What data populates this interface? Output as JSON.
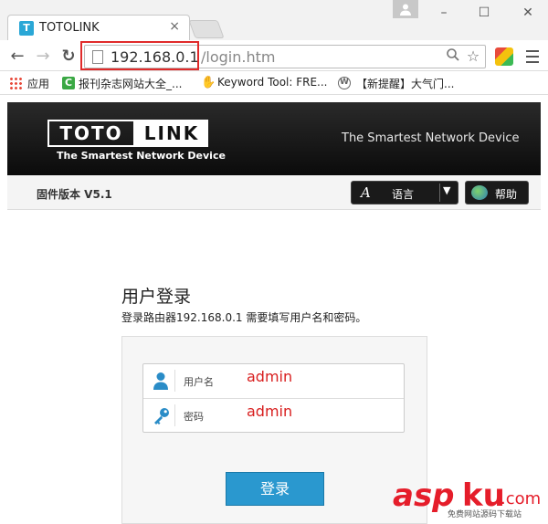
{
  "browser": {
    "tab_title": "TOTOLINK",
    "tab_favicon": "T",
    "url_host": "192.168.0.1",
    "url_path": "/login.htm",
    "bookmarks": [
      {
        "label": "应用",
        "icon": "apps-grid-icon"
      },
      {
        "label": "报刊杂志网站大全_...",
        "icon": "green-c-icon"
      },
      {
        "label": "Keyword Tool: FRE...",
        "icon": "keyword-tool-icon"
      },
      {
        "label": "【新提醒】大气门...",
        "icon": "wordpress-icon"
      }
    ],
    "accent": "#e02a2a"
  },
  "router": {
    "logo_left": "TOTO",
    "logo_right": "LINK",
    "logo_tagline": "The Smartest Network Device",
    "slogan": "The Smartest Network Device",
    "firmware": "固件版本 V5.1",
    "language_label": "语言",
    "help_label": "帮助",
    "login_title": "用户登录",
    "login_desc": "登录路由器192.168.0.1 需要填写用户名和密码。",
    "username_label": "用户名",
    "username_value": "admin",
    "password_label": "密码",
    "password_value": "admin",
    "submit_label": "登录",
    "brand_color": "#2a98cf"
  },
  "watermark": {
    "logo": "asp ku.com",
    "caption": "免费网站源码下载站"
  }
}
